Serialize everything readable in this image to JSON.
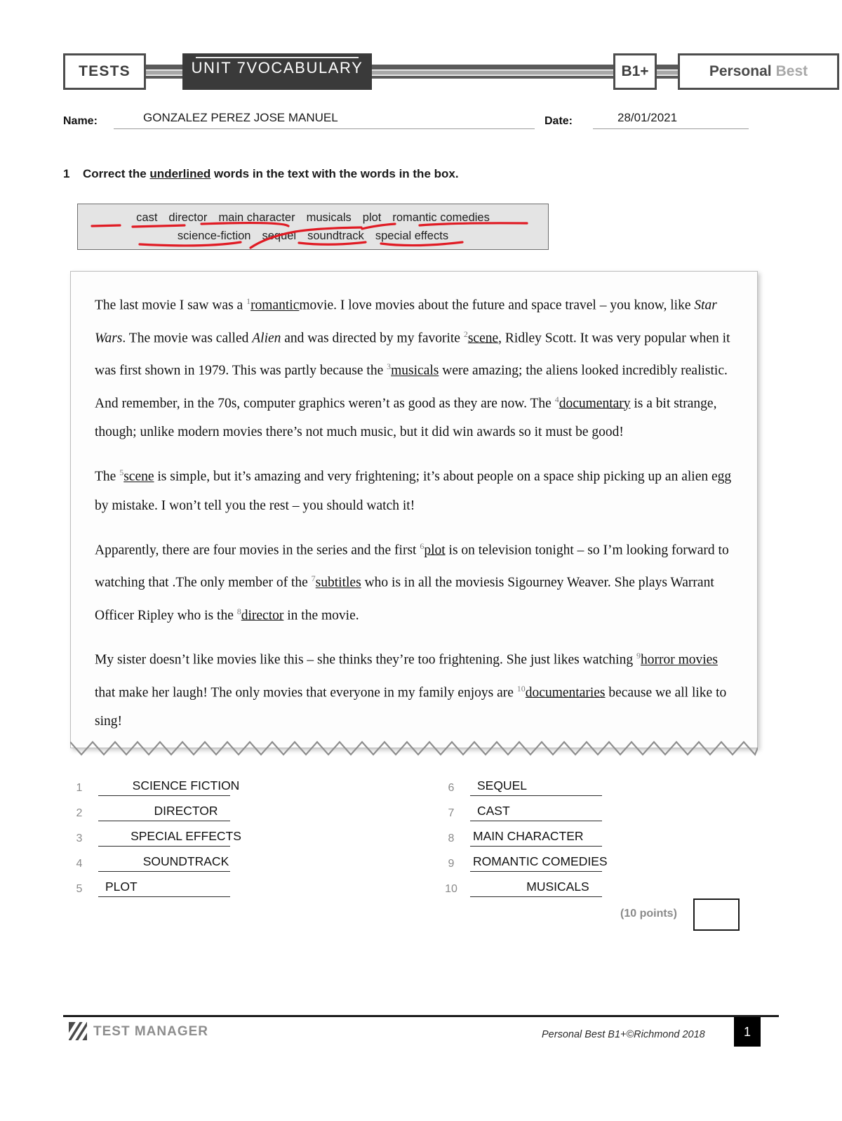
{
  "header": {
    "tests_label": "TESTS",
    "unit_label": "UNIT 7VOCABULARY",
    "level_label": "B1+",
    "brand_first": "Personal",
    "brand_second": "Best"
  },
  "meta": {
    "name_label": "Name:",
    "name_value": "GONZALEZ PEREZ JOSE MANUEL",
    "date_label": "Date:",
    "date_value": "28/01/2021"
  },
  "exercise": {
    "number": "1",
    "instruction_pre": "Correct the ",
    "instruction_underlined": "underlined",
    "instruction_post": " words in the text with the words in the box."
  },
  "wordbox": {
    "row1": [
      "cast",
      "director",
      "main character",
      "musicals",
      "plot",
      "romantic comedies"
    ],
    "row2": [
      "science-fiction",
      "sequel",
      "soundtrack",
      "special effects"
    ],
    "pen_color": "#e01b24"
  },
  "passage": {
    "p1_a": "The last movie I saw was a ",
    "p1_sup1": "1",
    "p1_gap1": "romantic",
    "p1_b": "movie. I love movies about the future and space travel – you know, like ",
    "p1_it1": "Star Wars",
    "p1_c": ". The movie was called ",
    "p1_it2": "Alien",
    "p1_d": " and was directed by my favorite ",
    "p1_sup2": "2",
    "p1_gap2": "scene",
    "p1_e": ", Ridley Scott. It was very popular when it was first shown in 1979. This was partly because the ",
    "p1_sup3": "3",
    "p1_gap3": "musicals",
    "p1_f": " were amazing; the aliens looked incredibly realistic. And remember, in the 70s, computer graphics weren’t as good as they are now. The ",
    "p1_sup4": "4",
    "p1_gap4": "documentary",
    "p1_g": " is a bit strange, though; unlike modern movies there’s not much music, but it did win awards so it must be good!",
    "p2_a": "The ",
    "p2_sup5": "5",
    "p2_gap5": "scene",
    "p2_b": " is simple, but it’s amazing and very frightening; it’s about people on a space ship picking up an alien egg by mistake. I won’t tell you the rest – you should watch it!",
    "p3_a": "Apparently, there are four movies in the series and the first ",
    "p3_sup6": "6",
    "p3_gap6": "plot",
    "p3_b": " is on television tonight – so I’m looking forward to watching that .The only member of the ",
    "p3_sup7": "7",
    "p3_gap7": "subtitles",
    "p3_c": " who is in all the moviesis Sigourney Weaver. She plays Warrant Officer Ripley who is the ",
    "p3_sup8": "8",
    "p3_gap8": "director",
    "p3_d": " in the movie.",
    "p4_a": "My sister doesn’t like movies like this – she thinks they’re too frightening. She just likes watching ",
    "p4_sup9": "9",
    "p4_gap9": "horror movies ",
    "p4_b": "that make her laugh! The only movies that everyone in my family enjoys are ",
    "p4_sup10": "10",
    "p4_gap10": "documentaries",
    "p4_c": " because we all like to sing!"
  },
  "answers": {
    "left": [
      {
        "n": "1",
        "value": "SCIENCE FICTION"
      },
      {
        "n": "2",
        "value": "DIRECTOR"
      },
      {
        "n": "3",
        "value": "SPECIAL EFFECTS"
      },
      {
        "n": "4",
        "value": "SOUNDTRACK"
      },
      {
        "n": "5",
        "value": "PLOT"
      }
    ],
    "right": [
      {
        "n": "6",
        "value": "SEQUEL"
      },
      {
        "n": "7",
        "value": "CAST"
      },
      {
        "n": "8",
        "value": "MAIN CHARACTER"
      },
      {
        "n": "9",
        "value": "ROMANTIC COMEDIES"
      },
      {
        "n": "10",
        "value": "MUSICALS"
      }
    ]
  },
  "points": {
    "label": "(10 points)",
    "score_value": ""
  },
  "footer": {
    "logo_text": "TEST MANAGER",
    "copyright": "Personal Best B1+©Richmond 2018",
    "page_number": "1"
  }
}
